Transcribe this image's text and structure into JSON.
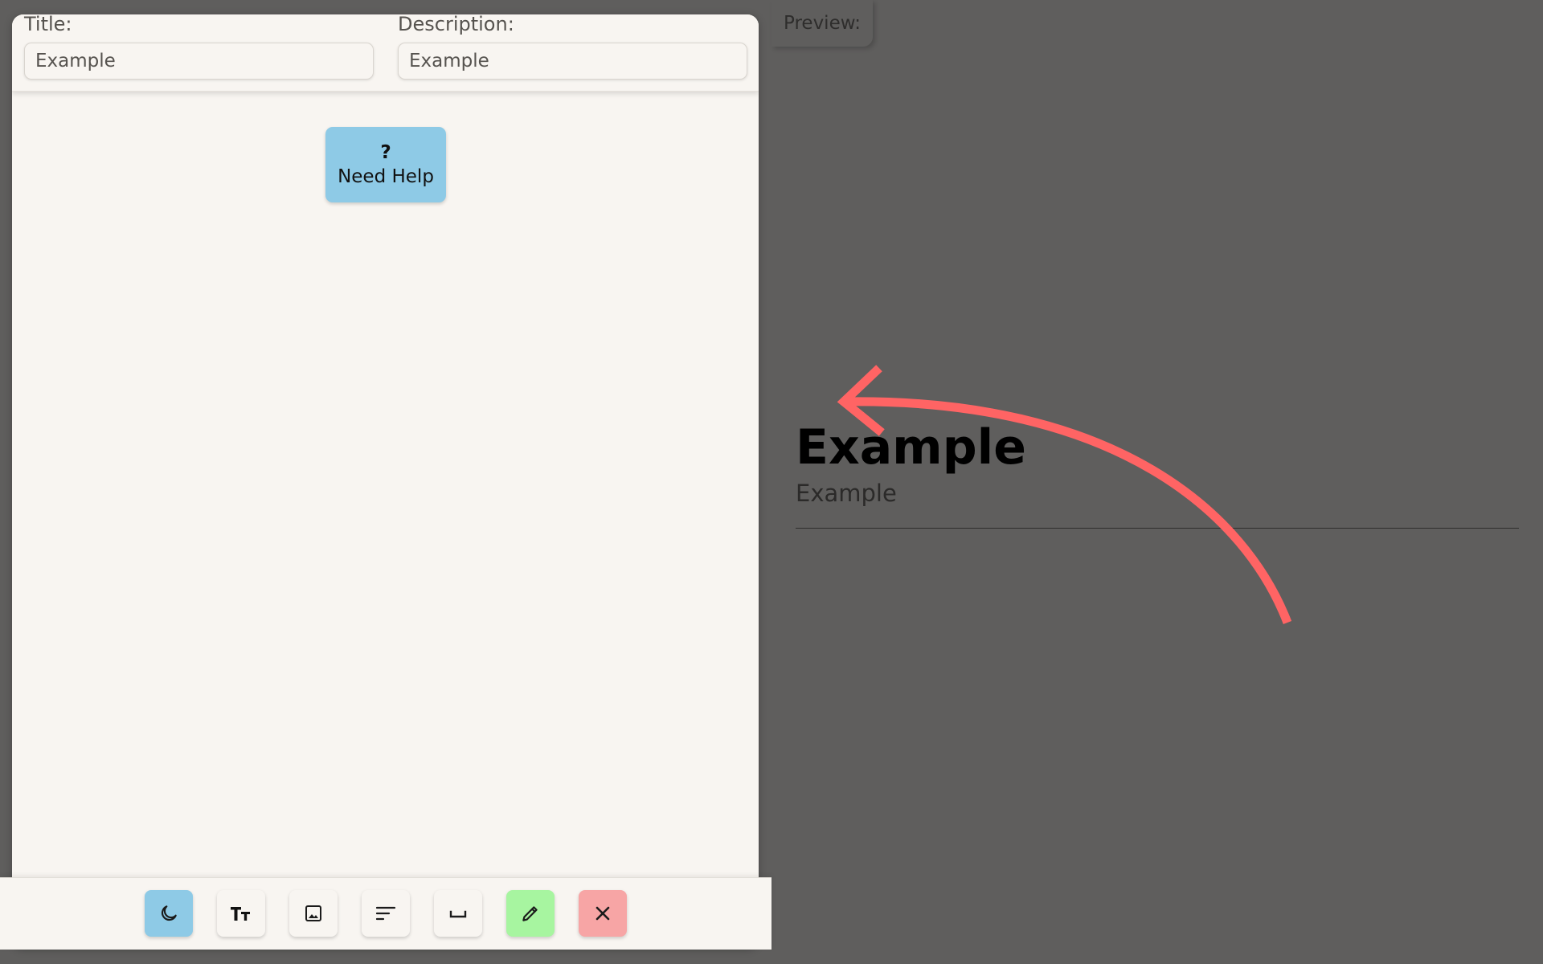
{
  "editor": {
    "title_field": {
      "label": "Title:",
      "value": "Example"
    },
    "description_field": {
      "label": "Description:",
      "value": "Example"
    },
    "help_button": {
      "icon": "?",
      "label": "Need Help"
    }
  },
  "toolbar": {
    "buttons": [
      {
        "name": "theme-toggle-button",
        "icon": "moon-icon",
        "color": "#8ecae6"
      },
      {
        "name": "text-size-button",
        "icon": "text-size-icon",
        "color": "#f8f5f1"
      },
      {
        "name": "insert-image-button",
        "icon": "image-icon",
        "color": "#f8f5f1"
      },
      {
        "name": "align-text-button",
        "icon": "align-left-icon",
        "color": "#f8f5f1"
      },
      {
        "name": "insert-space-button",
        "icon": "space-icon",
        "color": "#f8f5f1"
      },
      {
        "name": "edit-button",
        "icon": "pencil-icon",
        "color": "#a7f5a0"
      },
      {
        "name": "close-button",
        "icon": "close-icon",
        "color": "#f7a5a5"
      }
    ]
  },
  "preview": {
    "tab_label": "Preview:",
    "title": "Example",
    "description": "Example"
  },
  "colors": {
    "canvas_bg": "#5f5e5d",
    "panel_bg": "#f8f5f1",
    "help_bg": "#8ecae6",
    "annotation_arrow": "#ff6464"
  }
}
